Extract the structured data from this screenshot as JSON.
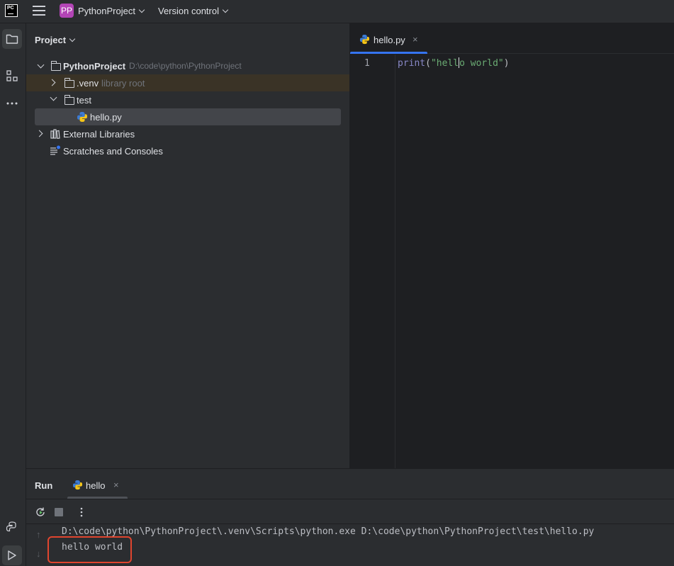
{
  "titlebar": {
    "app_logo_text": "PC",
    "project_badge": "PP",
    "project_name": "PythonProject",
    "vcs_label": "Version control"
  },
  "toolstrip": {
    "items": [
      "project-folder-icon",
      "structure-icon",
      "more-icon",
      "python-console-icon",
      "run-icon"
    ]
  },
  "project_panel": {
    "title": "Project",
    "tree": {
      "root_name": "PythonProject",
      "root_path": "D:\\code\\python\\PythonProject",
      "venv_name": ".venv",
      "venv_hint": "library root",
      "test_folder": "test",
      "file_name": "hello.py",
      "external_libs": "External Libraries",
      "scratches": "Scratches and Consoles"
    }
  },
  "editor": {
    "tab_label": "hello.py",
    "tab_close": "×",
    "line_number": "1",
    "code": {
      "fn": "print",
      "open": "(",
      "str_before_caret": "\"hell",
      "str_after_caret": "o world\"",
      "close": ")"
    }
  },
  "run_panel": {
    "title": "Run",
    "tab_label": "hello",
    "tab_close": "×",
    "console_command": "D:\\code\\python\\PythonProject\\.venv\\Scripts\\python.exe D:\\code\\python\\PythonProject\\test\\hello.py",
    "console_output": "hello world",
    "highlight_color": "#e0452f"
  },
  "colors": {
    "accent": "#3574f0",
    "background": "#1e1f22",
    "panel": "#2b2d30",
    "project_badge": "#b345b6"
  }
}
